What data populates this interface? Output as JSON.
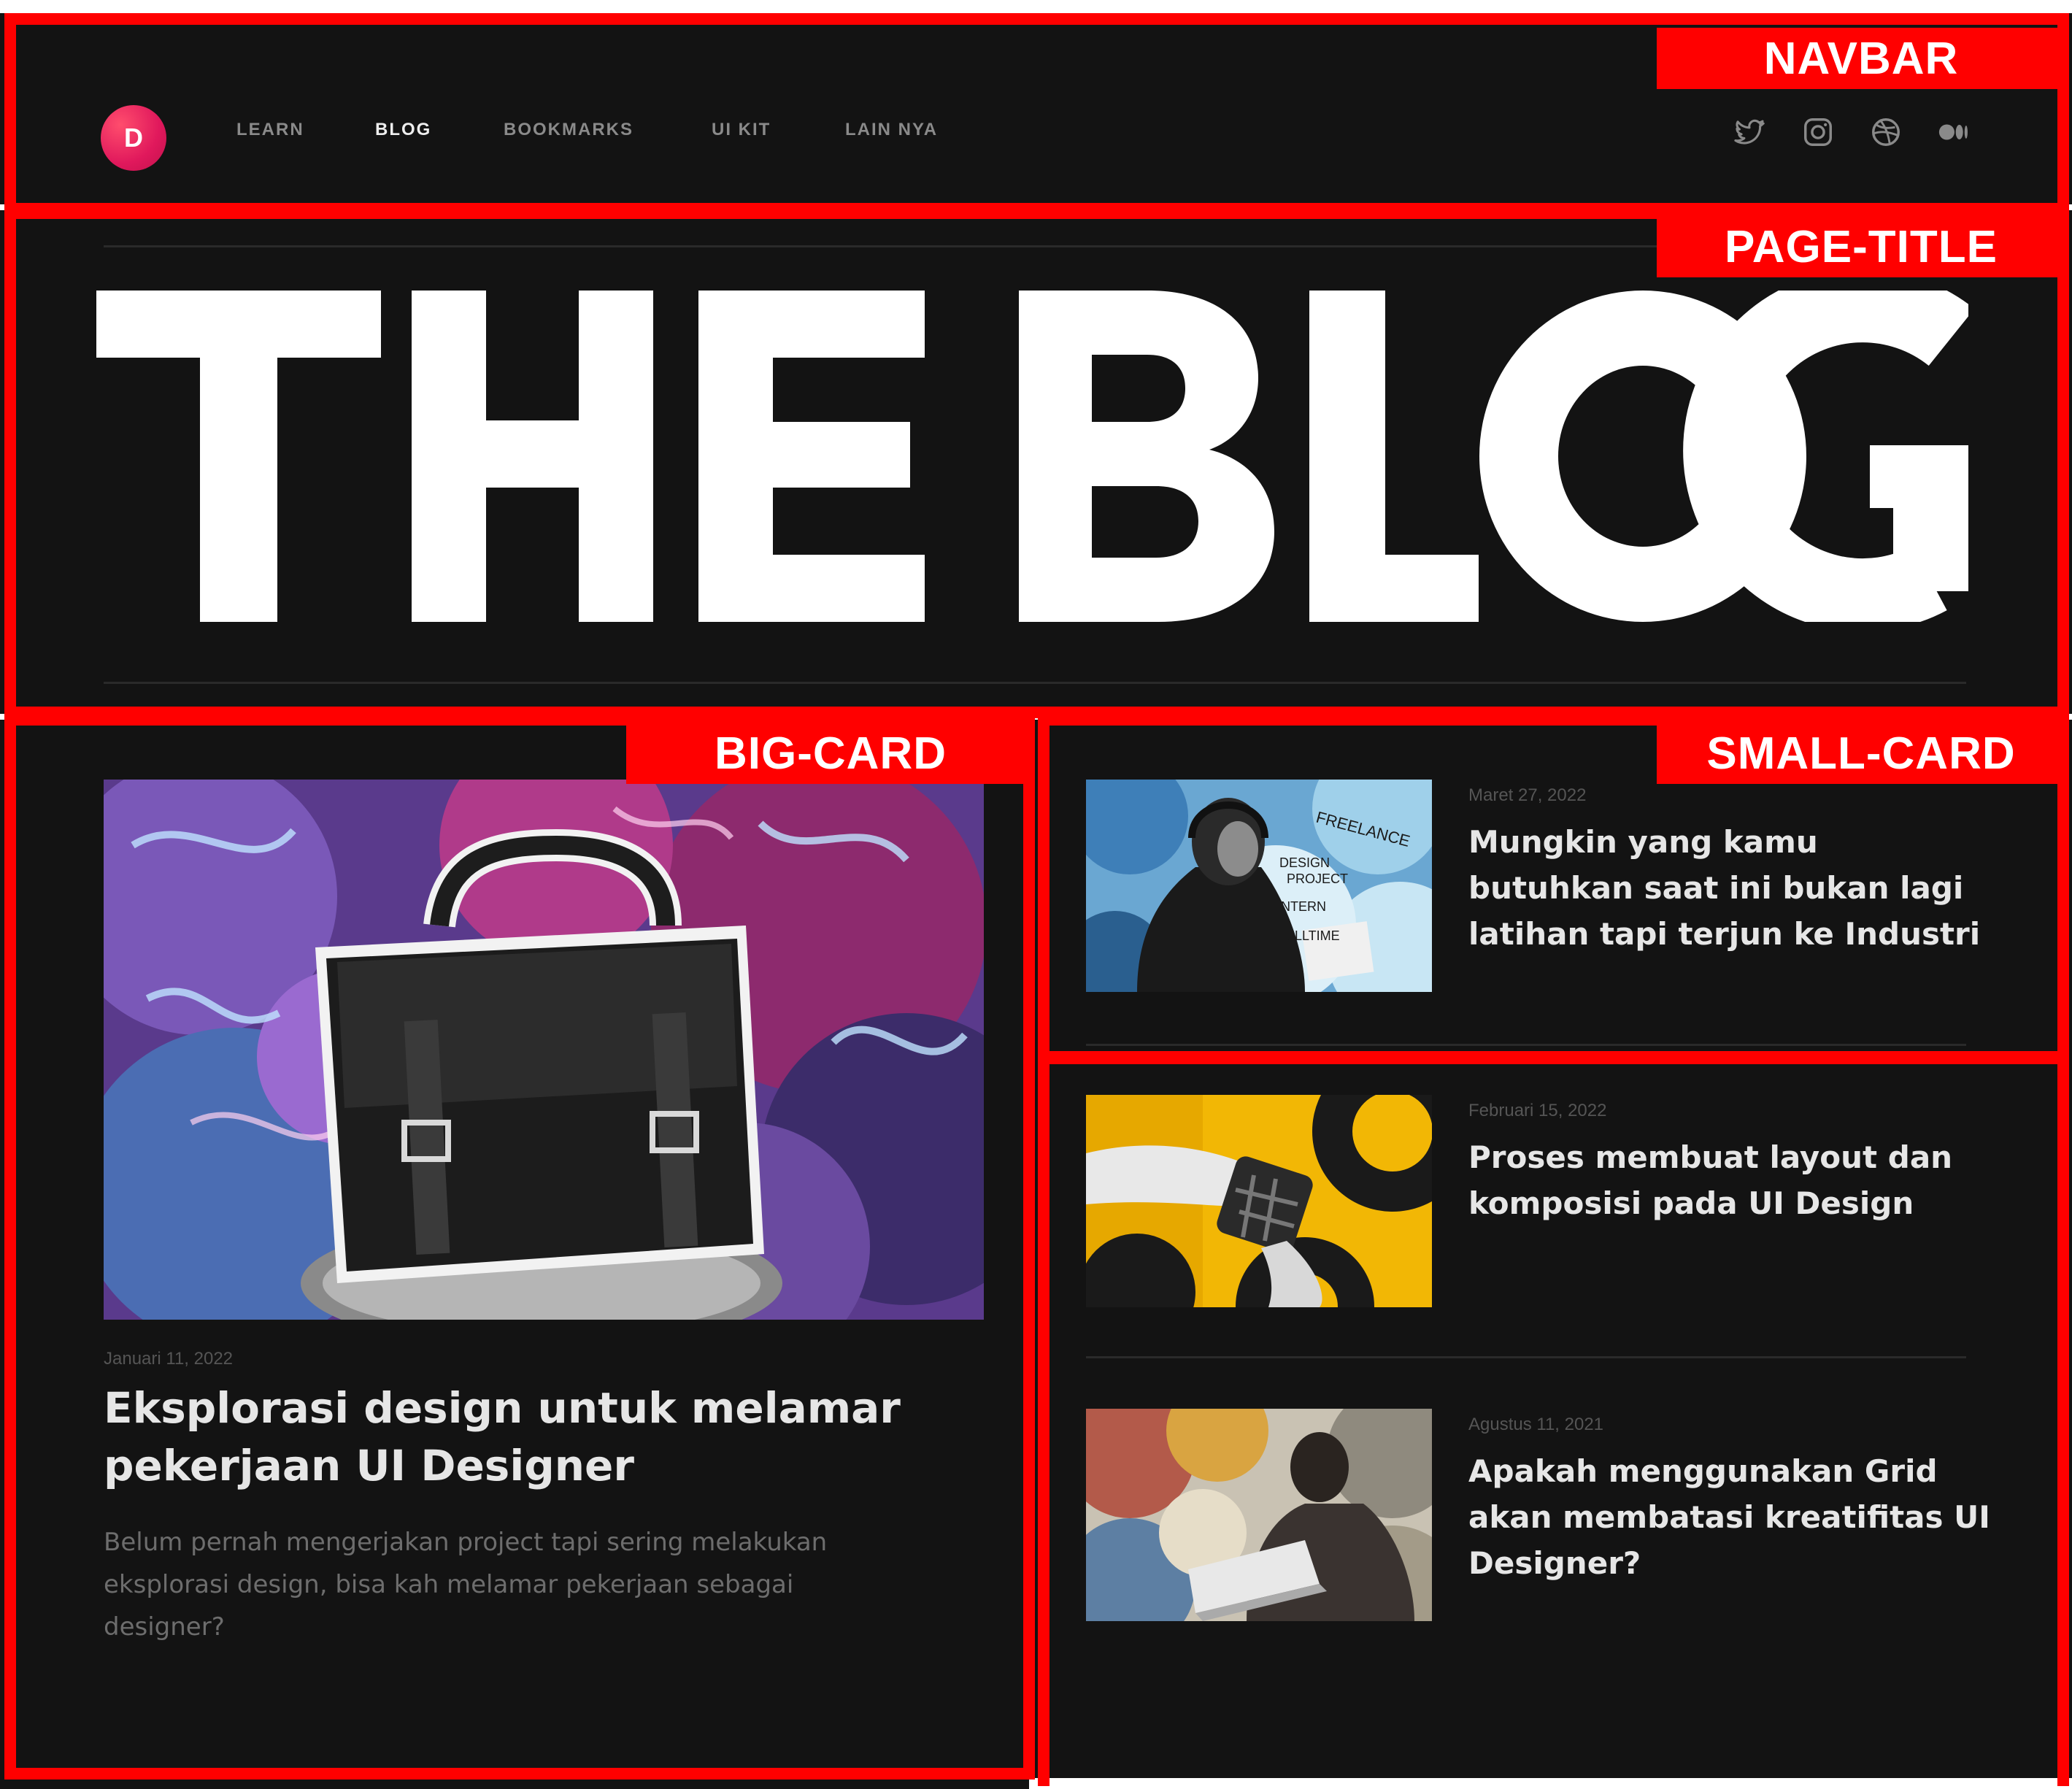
{
  "annotations": {
    "navbar": "NAVBAR",
    "page_title": "PAGE-TITLE",
    "big_card": "BIG-CARD",
    "small_card": "SMALL-CARD"
  },
  "colors": {
    "background": "#131313",
    "annotation": "#ff0000",
    "logo_accent": "#e0185c",
    "text_primary": "#e6e6e6",
    "text_muted": "#6d6d6d"
  },
  "navbar": {
    "logo_letter": "D",
    "links": [
      "LEARN",
      "BLOG",
      "BOOKMARKS",
      "UI KIT",
      "LAIN NYA"
    ],
    "active_link": "BLOG",
    "social_icons": [
      "twitter-icon",
      "instagram-icon",
      "dribbble-icon",
      "medium-icon"
    ]
  },
  "page_title": "THE BLOG",
  "big_card": {
    "date": "Januari 11, 2022",
    "title_line1": "Eksplorasi design untuk melamar",
    "title_line2": "pekerjaan UI Designer",
    "excerpt_line1": "Belum pernah mengerjakan project tapi sering melakukan",
    "excerpt_line2": "eksplorasi design, bisa kah melamar pekerjaan sebagai",
    "excerpt_line3": "designer?"
  },
  "small_cards": [
    {
      "date": "Maret 27, 2022",
      "lines": [
        "Mungkin yang kamu",
        "butuhkan saat ini bukan lagi",
        "latihan tapi terjun ke Industri"
      ],
      "image_words": [
        "FREELANCE",
        "DESIGN",
        "PROJECT",
        "INTERN",
        "FULLTIME"
      ]
    },
    {
      "date": "Februari 15, 2022",
      "lines": [
        "Proses membuat layout dan",
        "komposisi pada UI Design"
      ]
    },
    {
      "date": "Agustus 11, 2021",
      "lines": [
        "Apakah menggunakan Grid",
        "akan membatasi kreatifitas UI",
        "Designer?"
      ]
    }
  ]
}
